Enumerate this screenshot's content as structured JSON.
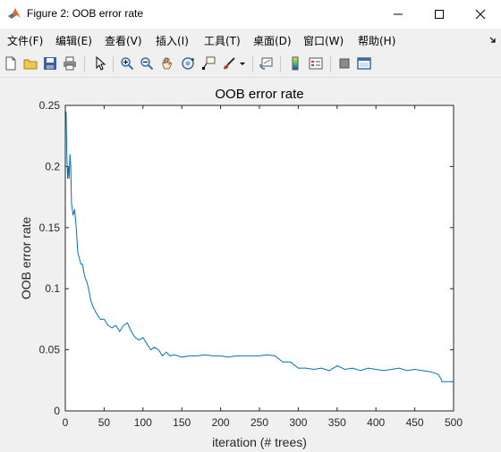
{
  "window": {
    "title": "Figure 2: OOB error rate"
  },
  "menu": [
    {
      "label": "文件(F)"
    },
    {
      "label": "编辑(E)"
    },
    {
      "label": "查看(V)"
    },
    {
      "label": "插入(I)"
    },
    {
      "label": "工具(T)"
    },
    {
      "label": "桌面(D)"
    },
    {
      "label": "窗口(W)"
    },
    {
      "label": "帮助(H)"
    }
  ],
  "toolbar_icons": [
    "new-figure-icon",
    "open-file-icon",
    "save-icon",
    "print-icon",
    "edit-plot-arrow-icon",
    "zoom-in-icon",
    "zoom-out-icon",
    "pan-hand-icon",
    "rotate-3d-icon",
    "data-cursor-icon",
    "brush-icon",
    "brush-dropdown-icon",
    "link-plot-icon",
    "colorbar-icon",
    "legend-icon",
    "hide-plot-tools-icon",
    "show-plot-tools-icon"
  ],
  "chart_data": {
    "type": "line",
    "title": "OOB error rate",
    "xlabel": "iteration (# trees)",
    "ylabel": "OOB error rate",
    "xlim": [
      0,
      500
    ],
    "ylim": [
      0,
      0.25
    ],
    "xticks": [
      "0",
      "50",
      "100",
      "150",
      "200",
      "250",
      "300",
      "350",
      "400",
      "450",
      "500"
    ],
    "yticks": [
      "0",
      "0.05",
      "0.1",
      "0.15",
      "0.2",
      "0.25"
    ],
    "grid": false,
    "color": "#0072bd",
    "series": [
      {
        "x": [
          1,
          2,
          3,
          4,
          5,
          6,
          7,
          8,
          10,
          12,
          14,
          16,
          18,
          20,
          22,
          25,
          28,
          30,
          33,
          36,
          40,
          45,
          50,
          55,
          60,
          65,
          70,
          75,
          80,
          85,
          90,
          95,
          100,
          105,
          110,
          115,
          120,
          125,
          130,
          135,
          140,
          145,
          150,
          160,
          170,
          180,
          190,
          200,
          210,
          220,
          230,
          240,
          250,
          260,
          270,
          280,
          290,
          300,
          310,
          320,
          330,
          340,
          350,
          360,
          370,
          380,
          390,
          400,
          410,
          420,
          430,
          440,
          450,
          460,
          470,
          480,
          484,
          485,
          490,
          495,
          500
        ],
        "y": [
          0.245,
          0.21,
          0.19,
          0.2,
          0.19,
          0.21,
          0.2,
          0.17,
          0.16,
          0.165,
          0.15,
          0.13,
          0.125,
          0.12,
          0.12,
          0.11,
          0.105,
          0.1,
          0.09,
          0.085,
          0.08,
          0.075,
          0.075,
          0.07,
          0.068,
          0.07,
          0.065,
          0.07,
          0.072,
          0.065,
          0.06,
          0.058,
          0.06,
          0.055,
          0.05,
          0.052,
          0.05,
          0.045,
          0.048,
          0.045,
          0.046,
          0.045,
          0.044,
          0.045,
          0.045,
          0.046,
          0.045,
          0.045,
          0.044,
          0.045,
          0.045,
          0.045,
          0.045,
          0.046,
          0.045,
          0.04,
          0.04,
          0.035,
          0.035,
          0.034,
          0.035,
          0.033,
          0.037,
          0.034,
          0.035,
          0.033,
          0.035,
          0.034,
          0.033,
          0.034,
          0.035,
          0.033,
          0.034,
          0.033,
          0.032,
          0.03,
          0.026,
          0.024,
          0.024,
          0.024,
          0.024
        ]
      }
    ]
  }
}
